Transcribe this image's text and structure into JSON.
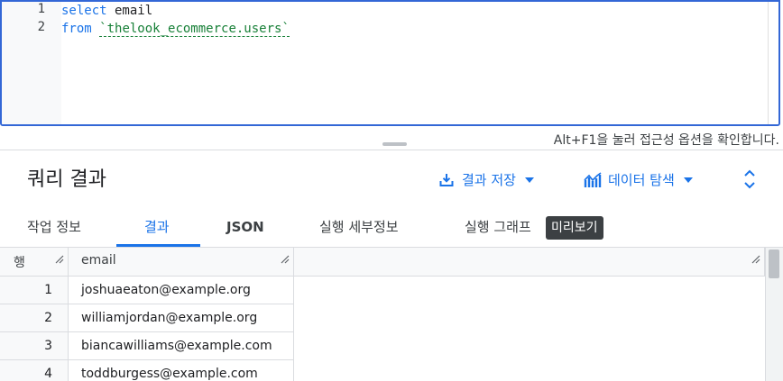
{
  "editor": {
    "lines": [
      {
        "number": "1",
        "keyword": "select",
        "rest": " email",
        "string": ""
      },
      {
        "number": "2",
        "keyword": "from",
        "rest": " ",
        "string": "`thelook_ecommerce.users`"
      }
    ]
  },
  "hint": "Alt+F1을 눌러 접근성 옵션을 확인합니다.",
  "results": {
    "title": "쿼리 결과",
    "save_label": "결과 저장",
    "explore_label": "데이터 탐색",
    "tabs": [
      {
        "label": "작업 정보"
      },
      {
        "label": "결과"
      },
      {
        "label": "JSON"
      },
      {
        "label": "실행 세부정보"
      },
      {
        "label": "실행 그래프"
      }
    ],
    "preview_badge": "미리보기",
    "table": {
      "row_header": "행",
      "columns": [
        "email"
      ],
      "rows": [
        {
          "n": "1",
          "email": "joshuaeaton@example.org"
        },
        {
          "n": "2",
          "email": "williamjordan@example.org"
        },
        {
          "n": "3",
          "email": "biancawilliams@example.com"
        },
        {
          "n": "4",
          "email": "toddburgess@example.com"
        }
      ]
    }
  },
  "colors": {
    "accent": "#1a73e8",
    "string": "#188038",
    "badge_bg": "#3c4043"
  },
  "icons": [
    "download-icon",
    "caret-down-icon",
    "chart-icon",
    "expand-collapse-icon",
    "column-resize-icon"
  ]
}
